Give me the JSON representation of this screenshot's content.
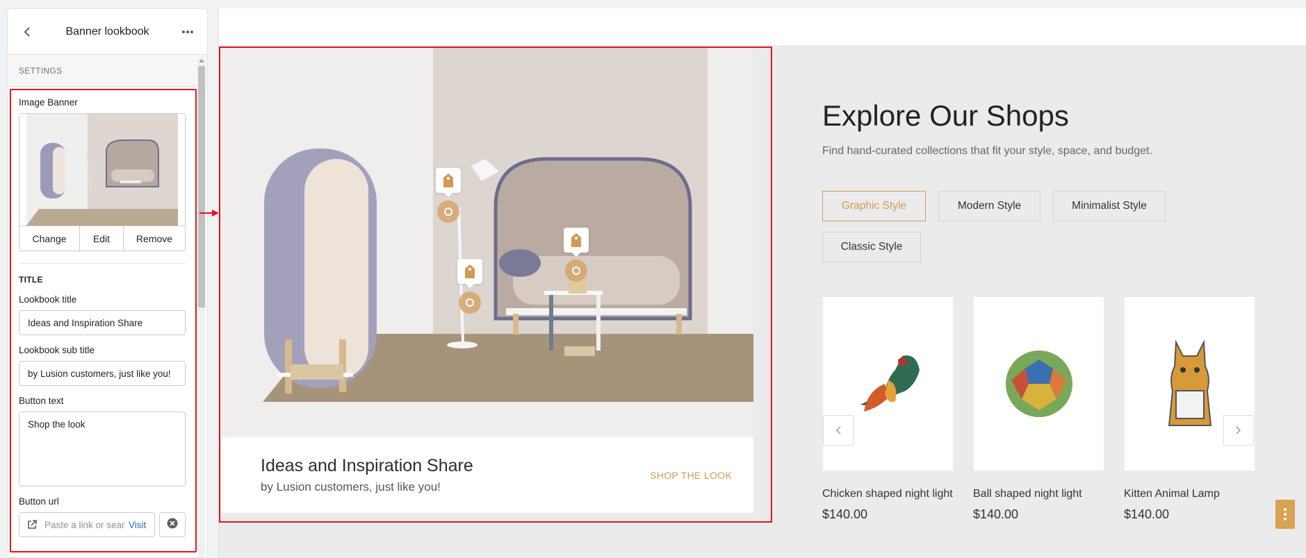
{
  "panel": {
    "title": "Banner lookbook",
    "back_icon": "chevron-left-icon",
    "more_icon": "more-horizontal-icon",
    "settings_label": "SETTINGS",
    "image_banner": {
      "label": "Image Banner",
      "buttons": [
        "Change",
        "Edit",
        "Remove"
      ]
    },
    "title_heading": "TITLE",
    "fields": {
      "lookbook_title_label": "Lookbook title",
      "lookbook_title_value": "Ideas and Inspiration Share",
      "lookbook_subtitle_label": "Lookbook sub title",
      "lookbook_subtitle_value": "by Lusion customers, just like you!",
      "button_text_label": "Button text",
      "button_text_value": "Shop the look",
      "button_url_label": "Button url",
      "button_url_placeholder": "Paste a link or sear",
      "visit_label": "Visit"
    }
  },
  "preview": {
    "lookbook": {
      "title": "Ideas and Inspiration Share",
      "subtitle": "by Lusion customers, just like you!",
      "cta": "SHOP THE LOOK"
    },
    "explore": {
      "title": "Explore Our Shops",
      "subtitle": "Find hand-curated collections that fit your style, space, and budget.",
      "filters": [
        "Graphic Style",
        "Modern Style",
        "Minimalist Style",
        "Classic Style"
      ],
      "active_filter": "Graphic Style"
    },
    "products": [
      {
        "name": "Chicken shaped night light",
        "price": "$140.00"
      },
      {
        "name": "Ball shaped night light",
        "price": "$140.00"
      },
      {
        "name": "Kitten Animal Lamp",
        "price": "$140.00"
      }
    ]
  },
  "colors": {
    "accent": "#d19a55",
    "highlight_red": "#e0161e",
    "link_blue": "#2c6ecb"
  }
}
